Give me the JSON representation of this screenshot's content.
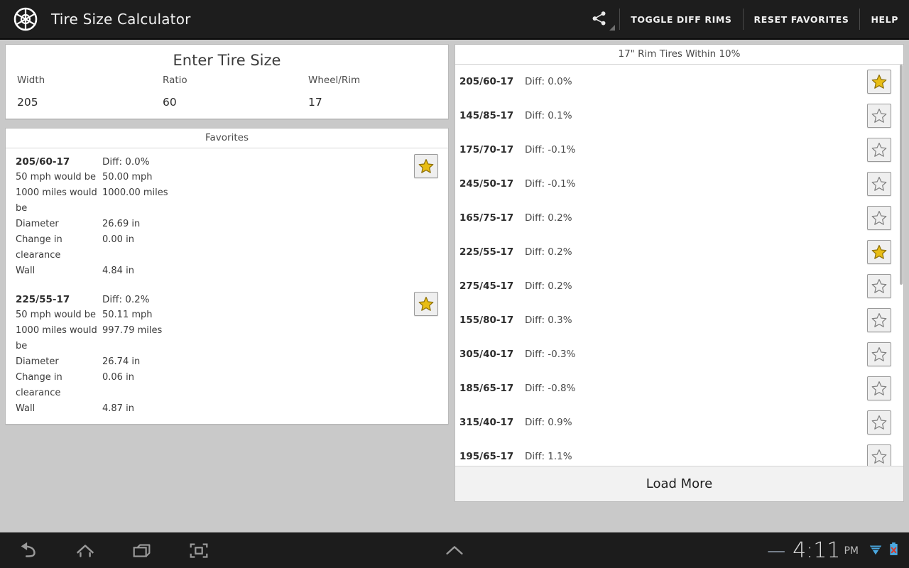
{
  "actionbar": {
    "logo_icon": "wheel-rim-icon",
    "title": "Tire Size Calculator",
    "share_icon": "share-icon",
    "buttons": [
      {
        "label": "TOGGLE DIFF RIMS"
      },
      {
        "label": "RESET FAVORITES"
      },
      {
        "label": "HELP"
      }
    ]
  },
  "enter_tire_size": {
    "title": "Enter Tire Size",
    "fields": [
      {
        "label": "Width",
        "value": "205"
      },
      {
        "label": "Ratio",
        "value": "60"
      },
      {
        "label": "Wheel/Rim",
        "value": "17"
      }
    ]
  },
  "favorites": {
    "header": "Favorites",
    "items": [
      {
        "size": "205/60-17",
        "diff": "Diff: 0.0%",
        "starred": true,
        "rows": [
          {
            "key": "50 mph would be",
            "value": "50.00 mph"
          },
          {
            "key": "1000 miles would be",
            "value": "1000.00 miles"
          },
          {
            "key": "Diameter",
            "value": "26.69 in"
          },
          {
            "key": "Change in clearance",
            "value": "0.00 in"
          },
          {
            "key": "Wall",
            "value": "4.84 in"
          }
        ]
      },
      {
        "size": "225/55-17",
        "diff": "Diff: 0.2%",
        "starred": true,
        "rows": [
          {
            "key": "50 mph would be",
            "value": "50.11 mph"
          },
          {
            "key": "1000 miles would be",
            "value": "997.79 miles"
          },
          {
            "key": "Diameter",
            "value": "26.74 in"
          },
          {
            "key": "Change in clearance",
            "value": "0.06 in"
          },
          {
            "key": "Wall",
            "value": "4.87 in"
          }
        ]
      }
    ]
  },
  "results": {
    "header": "17\" Rim Tires Within 10%",
    "load_more_label": "Load More",
    "rows": [
      {
        "size": "205/60-17",
        "diff": "Diff: 0.0%",
        "starred": true
      },
      {
        "size": "145/85-17",
        "diff": "Diff: 0.1%",
        "starred": false
      },
      {
        "size": "175/70-17",
        "diff": "Diff: -0.1%",
        "starred": false
      },
      {
        "size": "245/50-17",
        "diff": "Diff: -0.1%",
        "starred": false
      },
      {
        "size": "165/75-17",
        "diff": "Diff: 0.2%",
        "starred": false
      },
      {
        "size": "225/55-17",
        "diff": "Diff: 0.2%",
        "starred": true
      },
      {
        "size": "275/45-17",
        "diff": "Diff: 0.2%",
        "starred": false
      },
      {
        "size": "155/80-17",
        "diff": "Diff: 0.3%",
        "starred": false
      },
      {
        "size": "305/40-17",
        "diff": "Diff: -0.3%",
        "starred": false
      },
      {
        "size": "185/65-17",
        "diff": "Diff: -0.8%",
        "starred": false
      },
      {
        "size": "315/40-17",
        "diff": "Diff: 0.9%",
        "starred": false
      },
      {
        "size": "195/65-17",
        "diff": "Diff: 1.1%",
        "starred": false
      }
    ]
  },
  "system_bar": {
    "back_icon": "back-arrow-icon",
    "home_icon": "home-icon",
    "recents_icon": "recent-apps-icon",
    "screenshot_icon": "screenshot-icon",
    "expand_icon": "chevron-up-icon",
    "dash": "—",
    "clock": "4:11",
    "ampm": "PM",
    "wifi_icon": "wifi-icon",
    "battery_icon": "battery-error-icon"
  },
  "colors": {
    "star_gold": "#e8bd14",
    "actionbar_bg": "#1d1d1d",
    "page_bg": "#c9c9c9",
    "card_bg": "#ffffff"
  }
}
